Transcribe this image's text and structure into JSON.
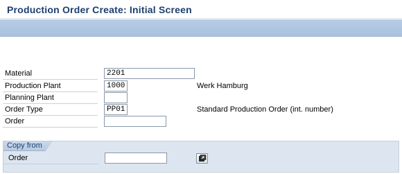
{
  "window": {
    "title": "Production Order Create: Initial Screen"
  },
  "form": {
    "material": {
      "label": "Material",
      "value": "2201"
    },
    "production_plant": {
      "label": "Production Plant",
      "value": "1000",
      "description": "Werk Hamburg"
    },
    "planning_plant": {
      "label": "Planning Plant",
      "value": ""
    },
    "order_type": {
      "label": "Order Type",
      "value": "PP01",
      "description": "Standard Production Order (int. number)"
    },
    "order": {
      "label": "Order",
      "value": ""
    }
  },
  "copy_from": {
    "title": "Copy from",
    "order": {
      "label": "Order",
      "value": ""
    },
    "button_icon": "copy-from-icon"
  }
}
